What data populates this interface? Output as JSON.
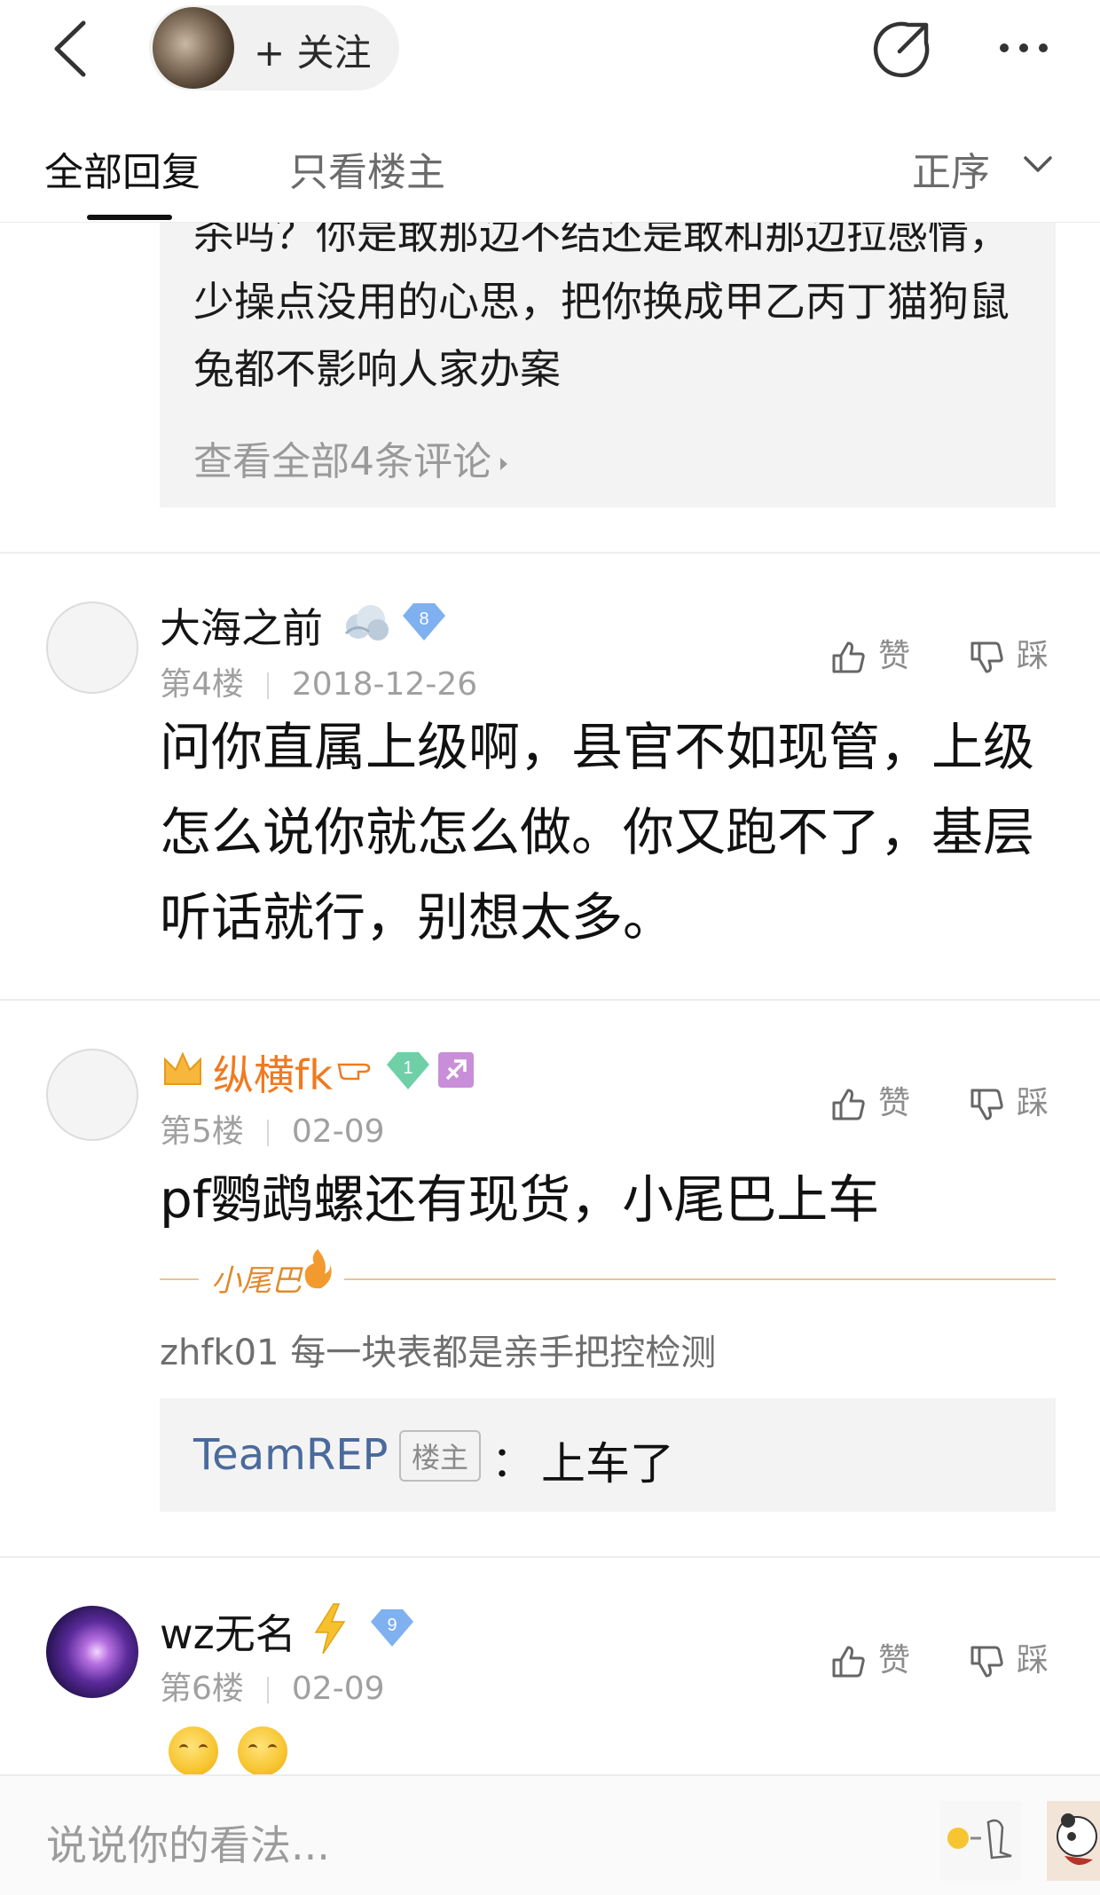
{
  "header": {
    "follow_label": "+ 关注",
    "icons": [
      "back-icon",
      "share-icon",
      "more-icon"
    ]
  },
  "tabs": {
    "all_replies": "全部回复",
    "only_lz": "只看楼主",
    "sort": "正序"
  },
  "floor3_sub": {
    "text": "杀吗？你是敢那边不结还是敢和那边拉感情，少操点没用的心思，把你换成甲乙丙丁猫狗鼠兔都不影响人家办案",
    "view_all": "查看全部4条评论"
  },
  "posts": [
    {
      "username": "大海之前",
      "level": "8",
      "floor": "第4楼",
      "date": "2018-12-26",
      "like_label": "赞",
      "dislike_label": "踩",
      "content": "问你直属上级啊，县官不如现管，上级怎么说你就怎么做。你又跑不了，基层听话就行，别想太多。"
    },
    {
      "username": "纵横fk",
      "level": "1",
      "floor": "第5楼",
      "date": "02-09",
      "like_label": "赞",
      "dislike_label": "踩",
      "content": "pf鹦鹉螺还有现货，小尾巴上车",
      "tail_label": "小尾巴",
      "tail_text": "zhfk01 每一块表都是亲手把控检测",
      "reply": {
        "user": "TeamREP",
        "tag": "楼主",
        "colon": "：",
        "text": "上车了"
      }
    },
    {
      "username": "wz无名",
      "level": "9",
      "floor": "第6楼",
      "date": "02-09",
      "like_label": "赞",
      "dislike_label": "踩"
    }
  ],
  "input": {
    "placeholder": "说说你的看法..."
  },
  "colors": {
    "accent_blue": "#4a6a9c",
    "vip_orange": "#f07a20",
    "tail_orange": "#e08a2c"
  }
}
